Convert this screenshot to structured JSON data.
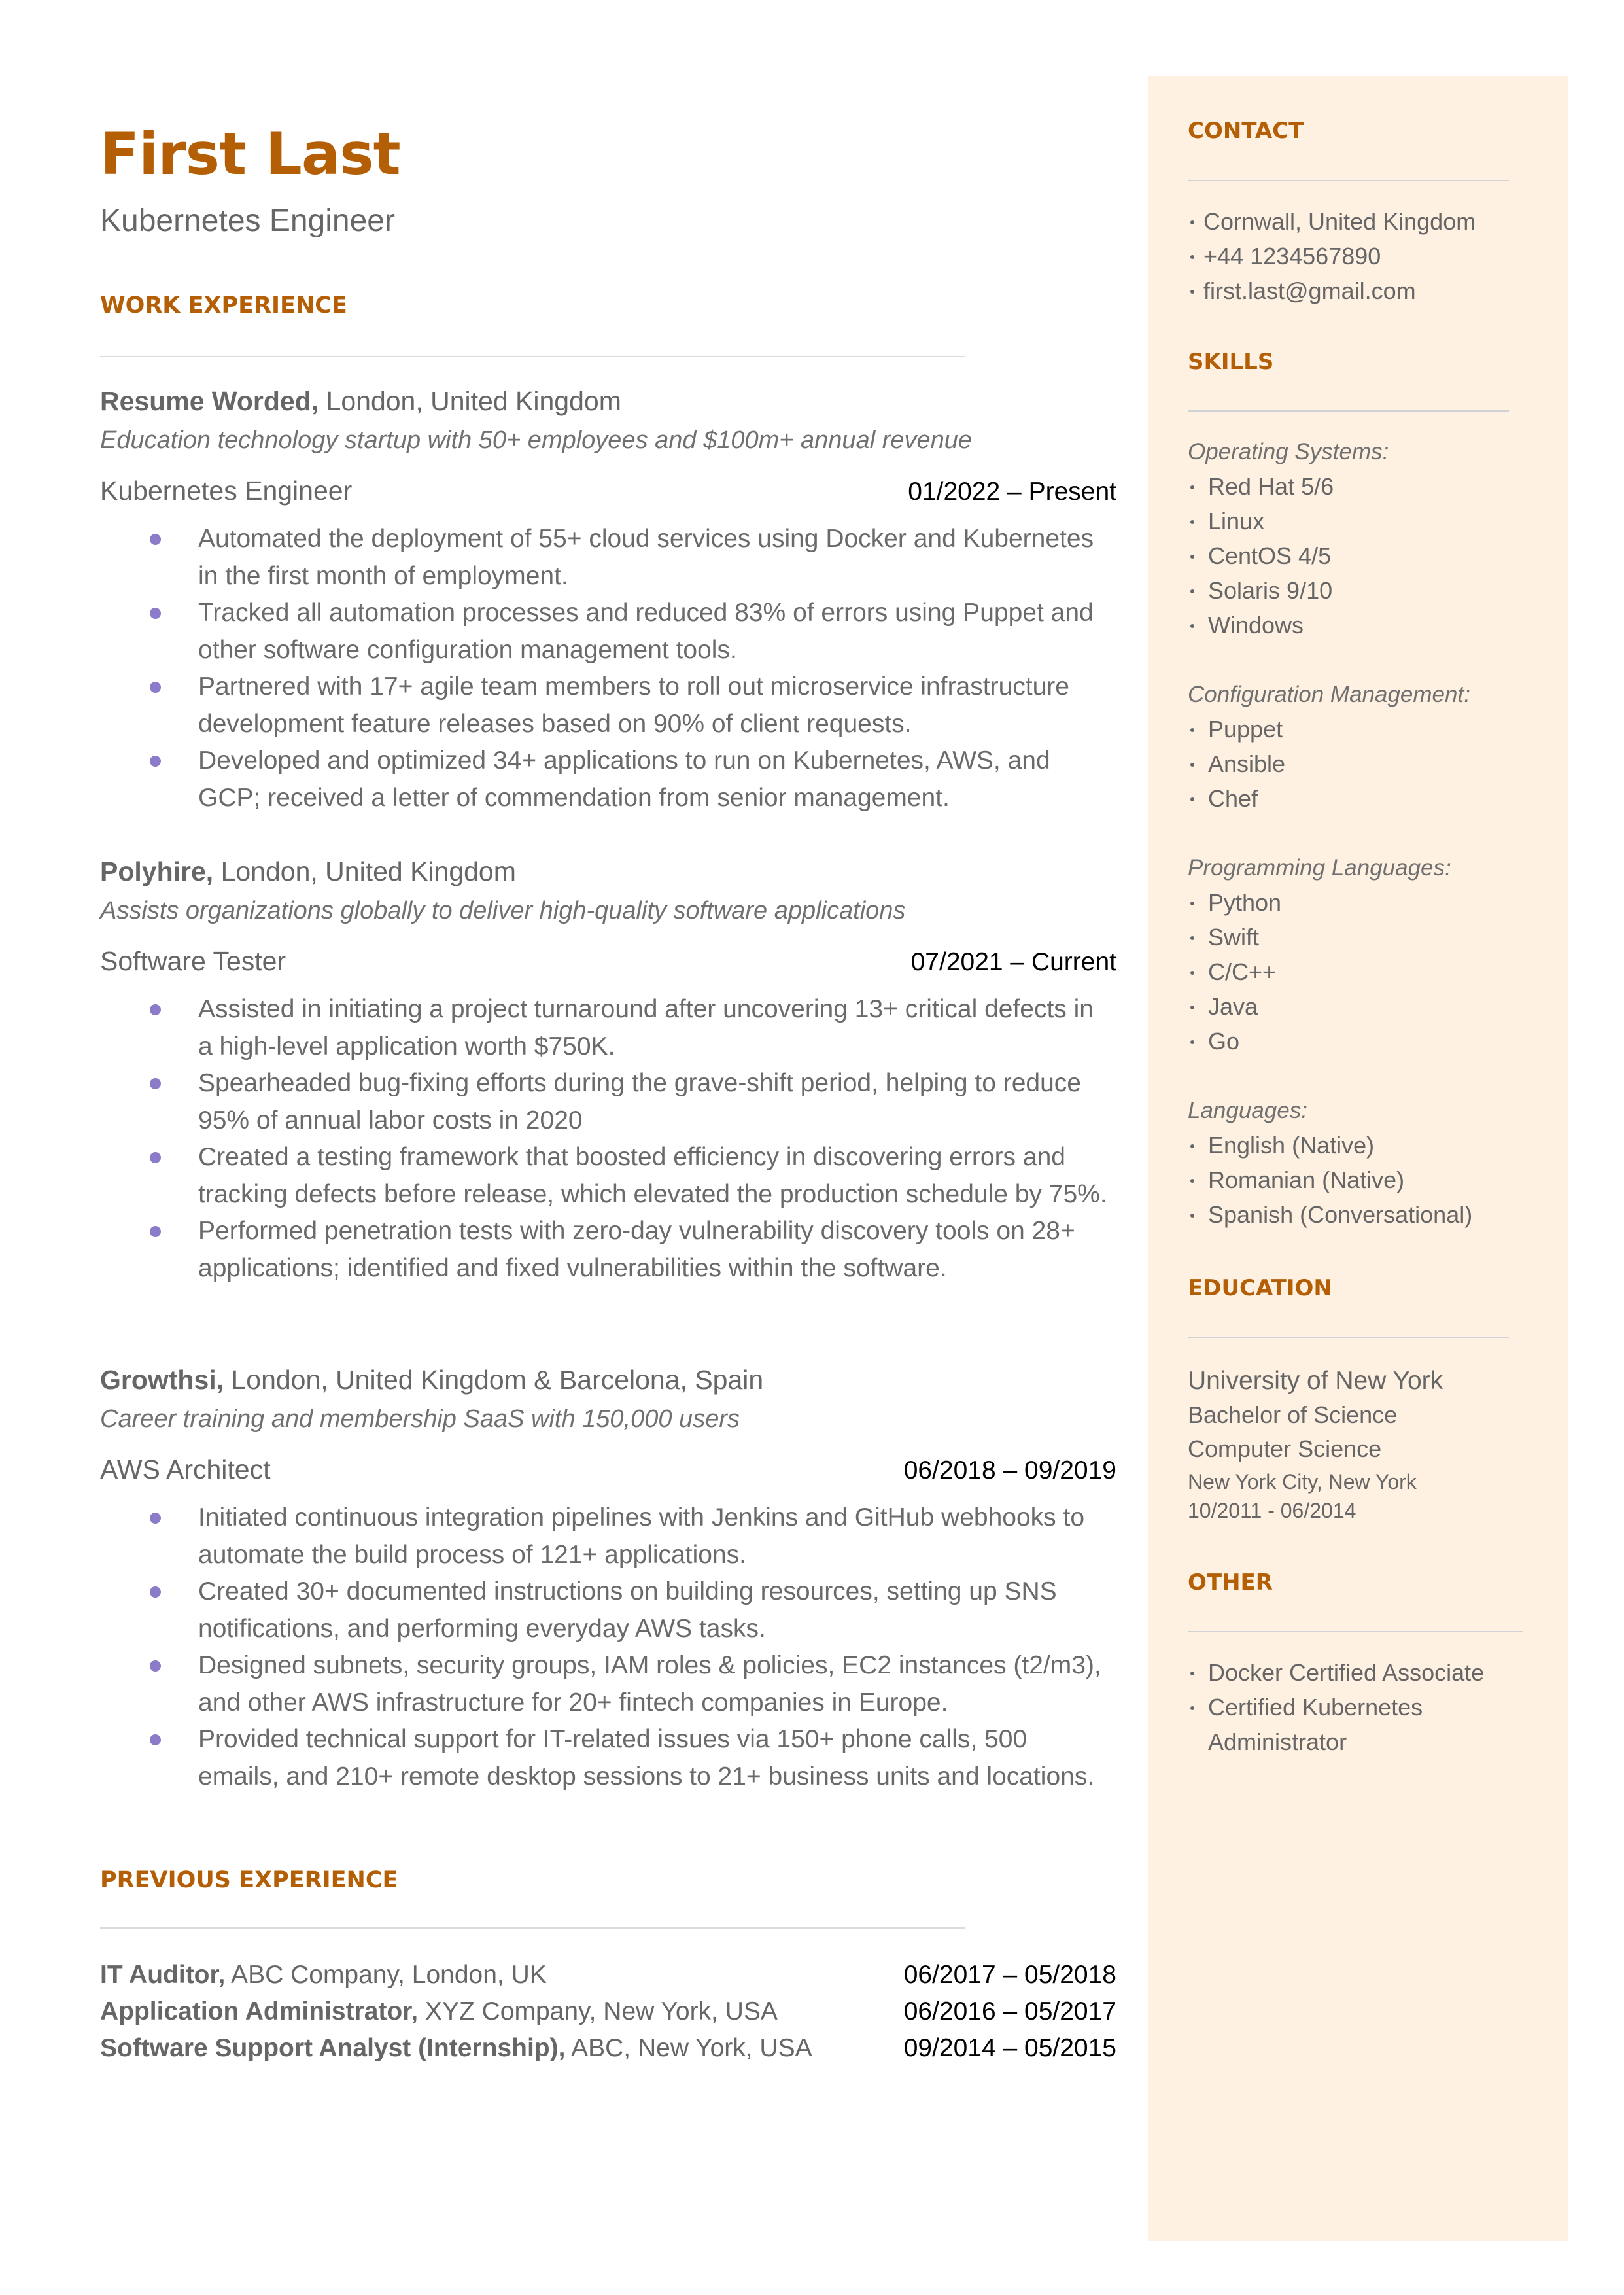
{
  "header": {
    "name": "First Last",
    "title": "Kubernetes Engineer"
  },
  "colors": {
    "accent": "#b45f06",
    "sidebar_bg": "#fef1e2",
    "bullet": "#8b7bc8",
    "text": "#666666"
  },
  "work_experience": {
    "heading": "WORK EXPERIENCE",
    "jobs": [
      {
        "company": "Resume Worded,",
        "location": " London, United Kingdom",
        "description": "Education technology startup with 50+ employees and $100m+ annual revenue",
        "role": "Kubernetes Engineer",
        "dates": "01/2022 – Present",
        "bullets": [
          "Automated the deployment of 55+ cloud services using Docker and Kubernetes in the first month of employment.",
          "Tracked all automation processes and reduced 83% of errors using Puppet and other software configuration management tools.",
          "Partnered with 17+ agile team members to roll out microservice infrastructure development feature releases based on 90% of client requests.",
          "Developed and optimized 34+ applications to run on Kubernetes, AWS, and GCP; received a letter of commendation from senior management."
        ]
      },
      {
        "company": "Polyhire,",
        "location": " London, United Kingdom",
        "description": "Assists organizations globally to deliver high-quality software applications",
        "role": "Software Tester",
        "dates": "07/2021 – Current",
        "bullets": [
          "Assisted in initiating a project turnaround after uncovering 13+ critical defects in a high-level application worth $750K.",
          "Spearheaded bug-fixing efforts during the grave-shift period, helping to reduce 95% of annual labor costs in 2020",
          "Created a testing framework that boosted efficiency in discovering errors and tracking defects before release, which elevated the production schedule by 75%.",
          "Performed penetration tests with zero-day vulnerability discovery tools on 28+ applications; identified and fixed vulnerabilities within the software."
        ]
      },
      {
        "company": "Growthsi,",
        "location": " London, United Kingdom & Barcelona, Spain",
        "description": "Career training and membership SaaS with 150,000 users",
        "role": "AWS Architect",
        "dates": "06/2018 – 09/2019",
        "bullets": [
          "Initiated continuous integration pipelines with Jenkins and GitHub webhooks to automate the build process of 121+ applications.",
          "Created 30+ documented instructions on building resources, setting up SNS notifications, and performing everyday AWS tasks.",
          "Designed subnets, security groups, IAM roles & policies, EC2 instances (t2/m3), and other AWS infrastructure for 20+ fintech companies in Europe.",
          "Provided technical support for IT-related issues via 150+ phone calls, 500 emails, and 210+ remote desktop sessions to 21+ business units and locations."
        ]
      }
    ]
  },
  "previous_experience": {
    "heading": "PREVIOUS EXPERIENCE",
    "items": [
      {
        "role": "IT Auditor,",
        "org": " ABC Company, London, UK",
        "dates": "06/2017 – 05/2018"
      },
      {
        "role": "Application Administrator,",
        "org": " XYZ Company, New York, USA",
        "dates": "06/2016 – 05/2017"
      },
      {
        "role": "Software Support Analyst (Internship),",
        "org": " ABC, New York, USA",
        "dates": "09/2014 – 05/2015"
      }
    ]
  },
  "sidebar": {
    "contact": {
      "heading": "CONTACT",
      "items": [
        "Cornwall, United Kingdom",
        "+44 1234567890",
        "first.last@gmail.com"
      ]
    },
    "skills": {
      "heading": "SKILLS",
      "groups": [
        {
          "category": "Operating Systems:",
          "items": [
            "Red Hat 5/6",
            "Linux",
            "CentOS 4/5",
            "Solaris 9/10",
            "Windows"
          ]
        },
        {
          "category": "Configuration Management:",
          "items": [
            "Puppet",
            "Ansible",
            "Chef"
          ]
        },
        {
          "category": "Programming Languages:",
          "items": [
            "Python",
            "Swift",
            "C/C++",
            "Java",
            "Go"
          ]
        },
        {
          "category": "Languages:",
          "items": [
            "English (Native)",
            "Romanian (Native)",
            "Spanish (Conversational)"
          ]
        }
      ]
    },
    "education": {
      "heading": "EDUCATION",
      "school": "University of New York",
      "degree": "Bachelor of Science",
      "field": "Computer Science",
      "location": "New York City, New York",
      "dates": "10/2011 - 06/2014"
    },
    "other": {
      "heading": "OTHER",
      "items": [
        "Docker Certified Associate",
        "Certified Kubernetes Administrator"
      ]
    }
  }
}
